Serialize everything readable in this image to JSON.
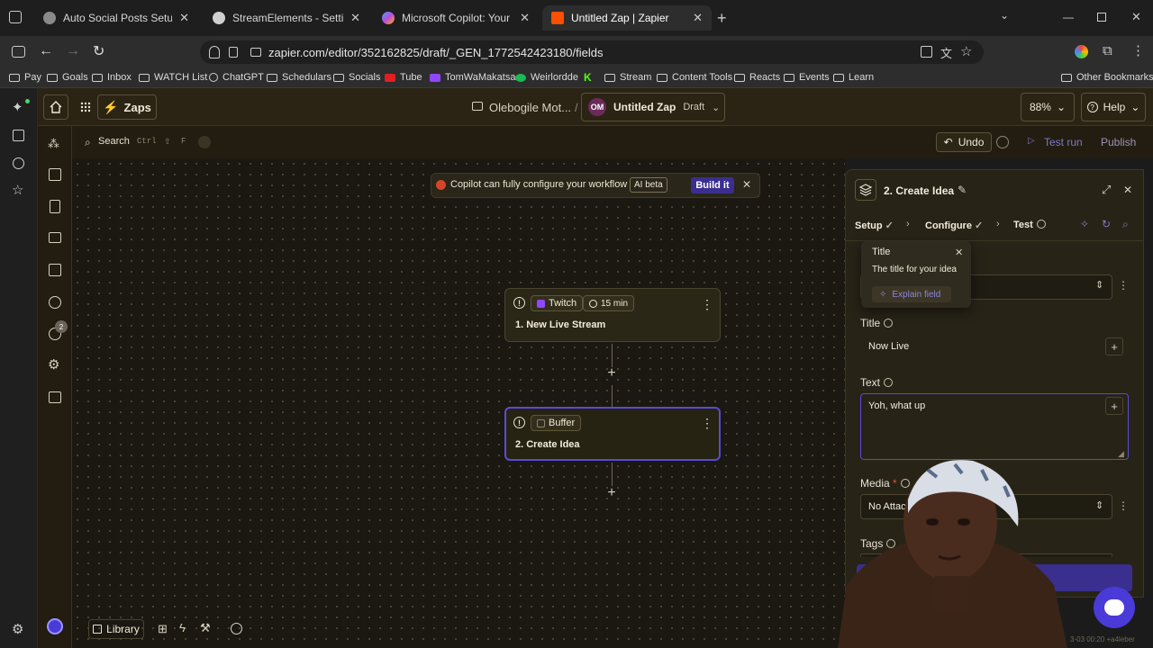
{
  "browser": {
    "tabs": [
      {
        "label": "Auto Social Posts Setup",
        "active": false,
        "color": "#7a7a7a"
      },
      {
        "label": "StreamElements - Settings",
        "active": false,
        "color": "#c9c9c9"
      },
      {
        "label": "Microsoft Copilot: Your AI comp",
        "active": false,
        "color": "#3aa0ff"
      },
      {
        "label": "Untitled Zap | Zapier",
        "active": true,
        "color": "#ff4f00"
      }
    ],
    "url": "zapier.com/editor/352162825/draft/_GEN_1772542423180/fields",
    "bookmarks": [
      "Pay",
      "Goals",
      "Inbox",
      "WATCH List",
      "ChatGPT",
      "Schedulars",
      "Socials",
      "Tube",
      "TomWaMakatsa",
      "Weirlordde",
      "Stream",
      "Content Tools",
      "Reacts",
      "Events",
      "Learn"
    ],
    "other_bookmarks": "Other Bookmarks"
  },
  "header": {
    "zaps_label": "Zaps",
    "folder": "Olebogile Mot...",
    "separator": "/",
    "avatar": "OM",
    "zap_name": "Untitled Zap",
    "status": "Draft",
    "zoom": "88%",
    "help": "Help"
  },
  "toolbar": {
    "search": "Search",
    "shortcut_ctrl": "Ctrl",
    "shortcut_shift": "⇧",
    "shortcut_f": "F",
    "undo": "Undo",
    "test_run": "Test run",
    "publish": "Publish"
  },
  "copilot": {
    "message": "Copilot can fully configure your workflow",
    "badge": "AI beta",
    "build": "Build it"
  },
  "steps": [
    {
      "app": "Twitch",
      "interval": "15 min",
      "title": "1. New Live Stream"
    },
    {
      "app": "Buffer",
      "title": "2. Create Idea"
    }
  ],
  "panel": {
    "title": "2. Create Idea",
    "tabs": [
      {
        "label": "Setup"
      },
      {
        "label": "Configure"
      },
      {
        "label": "Test"
      }
    ],
    "tooltip": {
      "title": "Title",
      "description": "The title for your idea",
      "explain": "Explain field"
    },
    "fields": {
      "title_label": "Title",
      "title_value": "Now Live",
      "text_label": "Text",
      "text_value": "Yoh, what up",
      "media_label": "Media",
      "media_required": "*",
      "media_value": "No Attachment",
      "tags_label": "Tags"
    }
  },
  "bottom": {
    "library": "Library"
  },
  "notifications_count": "2",
  "watermark": "3-03 00:20 +a4leber",
  "colors": {
    "accent": "#3a2f8f",
    "brand": "#ff4f00",
    "selected_border": "#5a4bd6"
  }
}
